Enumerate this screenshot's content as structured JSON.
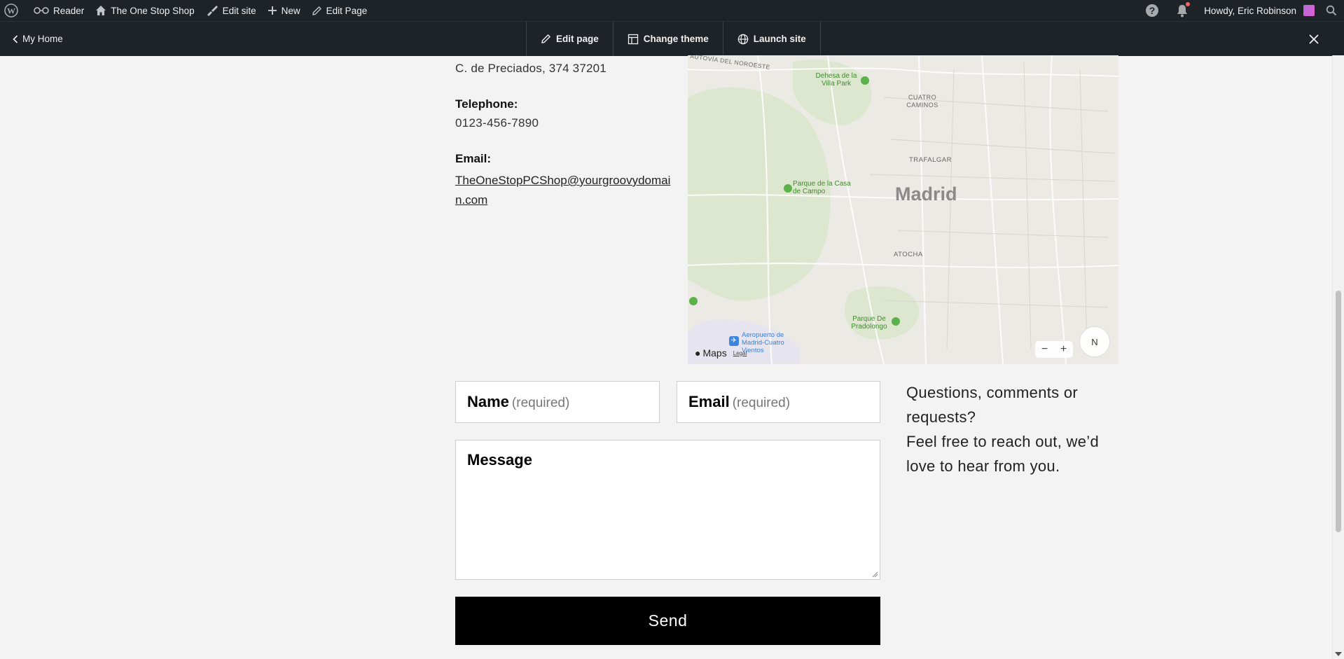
{
  "adminbar": {
    "reader": "Reader",
    "site_name": "The One Stop Shop",
    "edit_site": "Edit site",
    "new": "New",
    "edit_page": "Edit Page",
    "howdy": "Howdy, Eric Robinson"
  },
  "subbar": {
    "my_home": "My Home",
    "actions": [
      "Edit page",
      "Change theme",
      "Launch site"
    ]
  },
  "contact": {
    "address": "C. de Preciados, 374 37201",
    "telephone_label": "Telephone:",
    "telephone": "0123-456-7890",
    "email_label": "Email:",
    "email": "TheOneStopPCShop@yourgroovydomain.com"
  },
  "map": {
    "city": "Madrid",
    "labels": [
      "AUTOVÍA DEL NOROESTE",
      "Dehesa de la Villa Park",
      "CUATRO CAMINOS",
      "TRAFALGAR",
      "Parque de la Casa de Campo",
      "ATOCHA",
      "Parque De Pradolongo",
      "Aeropuerto de Madrid-Cuatro Vientos"
    ],
    "attribution": "Maps",
    "legal": "Legal",
    "compass": "N",
    "zoom_out": "−",
    "zoom_in": "+"
  },
  "form": {
    "name_label": "Name",
    "name_required": "(required)",
    "email_label": "Email",
    "email_required": "(required)",
    "message_label": "Message",
    "send": "Send"
  },
  "aside": {
    "line1": "Questions, comments or requests?",
    "line2": "Feel free to reach out, we’d love to hear from you."
  }
}
